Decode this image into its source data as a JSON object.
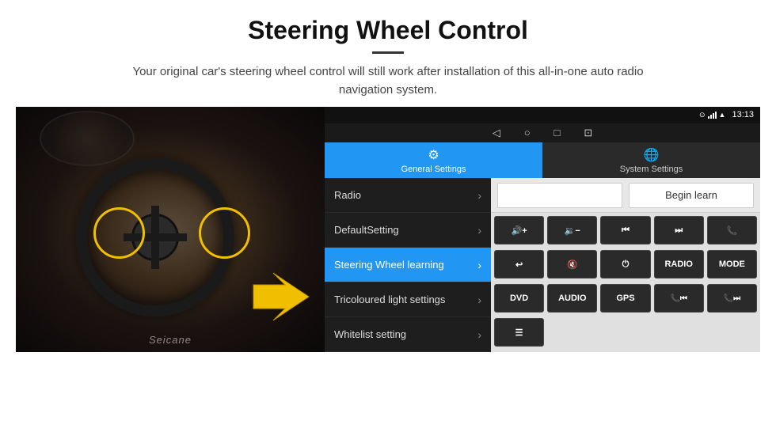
{
  "header": {
    "title": "Steering Wheel Control",
    "subtitle": "Your original car's steering wheel control will still work after installation of this all-in-one auto radio navigation system."
  },
  "statusBar": {
    "time": "13:13"
  },
  "tabs": [
    {
      "id": "general",
      "label": "General Settings",
      "icon": "⚙",
      "active": true
    },
    {
      "id": "system",
      "label": "System Settings",
      "icon": "🌐",
      "active": false
    }
  ],
  "menuItems": [
    {
      "id": "radio",
      "label": "Radio",
      "active": false
    },
    {
      "id": "defaultsetting",
      "label": "DefaultSetting",
      "active": false
    },
    {
      "id": "steeringwheel",
      "label": "Steering Wheel learning",
      "active": true
    },
    {
      "id": "tricoloured",
      "label": "Tricoloured light settings",
      "active": false
    },
    {
      "id": "whitelist",
      "label": "Whitelist setting",
      "active": false
    }
  ],
  "rightPanel": {
    "beginLearnLabel": "Begin learn",
    "buttons": [
      {
        "id": "vol-up",
        "label": "🔊+",
        "row": 1
      },
      {
        "id": "vol-down",
        "label": "🔉-",
        "row": 1
      },
      {
        "id": "prev-track",
        "label": "⏮",
        "row": 1
      },
      {
        "id": "next-track",
        "label": "⏭",
        "row": 1
      },
      {
        "id": "phone",
        "label": "📞",
        "row": 1
      },
      {
        "id": "back",
        "label": "↩",
        "row": 2
      },
      {
        "id": "mute",
        "label": "🔇",
        "row": 2
      },
      {
        "id": "power",
        "label": "⏻",
        "row": 2
      },
      {
        "id": "radio-btn",
        "label": "RADIO",
        "row": 2
      },
      {
        "id": "mode",
        "label": "MODE",
        "row": 2
      },
      {
        "id": "dvd",
        "label": "DVD",
        "row": 3
      },
      {
        "id": "audio",
        "label": "AUDIO",
        "row": 3
      },
      {
        "id": "gps",
        "label": "GPS",
        "row": 3
      },
      {
        "id": "tel-prev",
        "label": "📞⏮",
        "row": 3
      },
      {
        "id": "tel-next",
        "label": "📞⏭",
        "row": 3
      },
      {
        "id": "list",
        "label": "☰",
        "row": 4
      }
    ]
  },
  "watermark": "Seicane",
  "navIcons": [
    "◁",
    "○",
    "□",
    "⬛"
  ]
}
